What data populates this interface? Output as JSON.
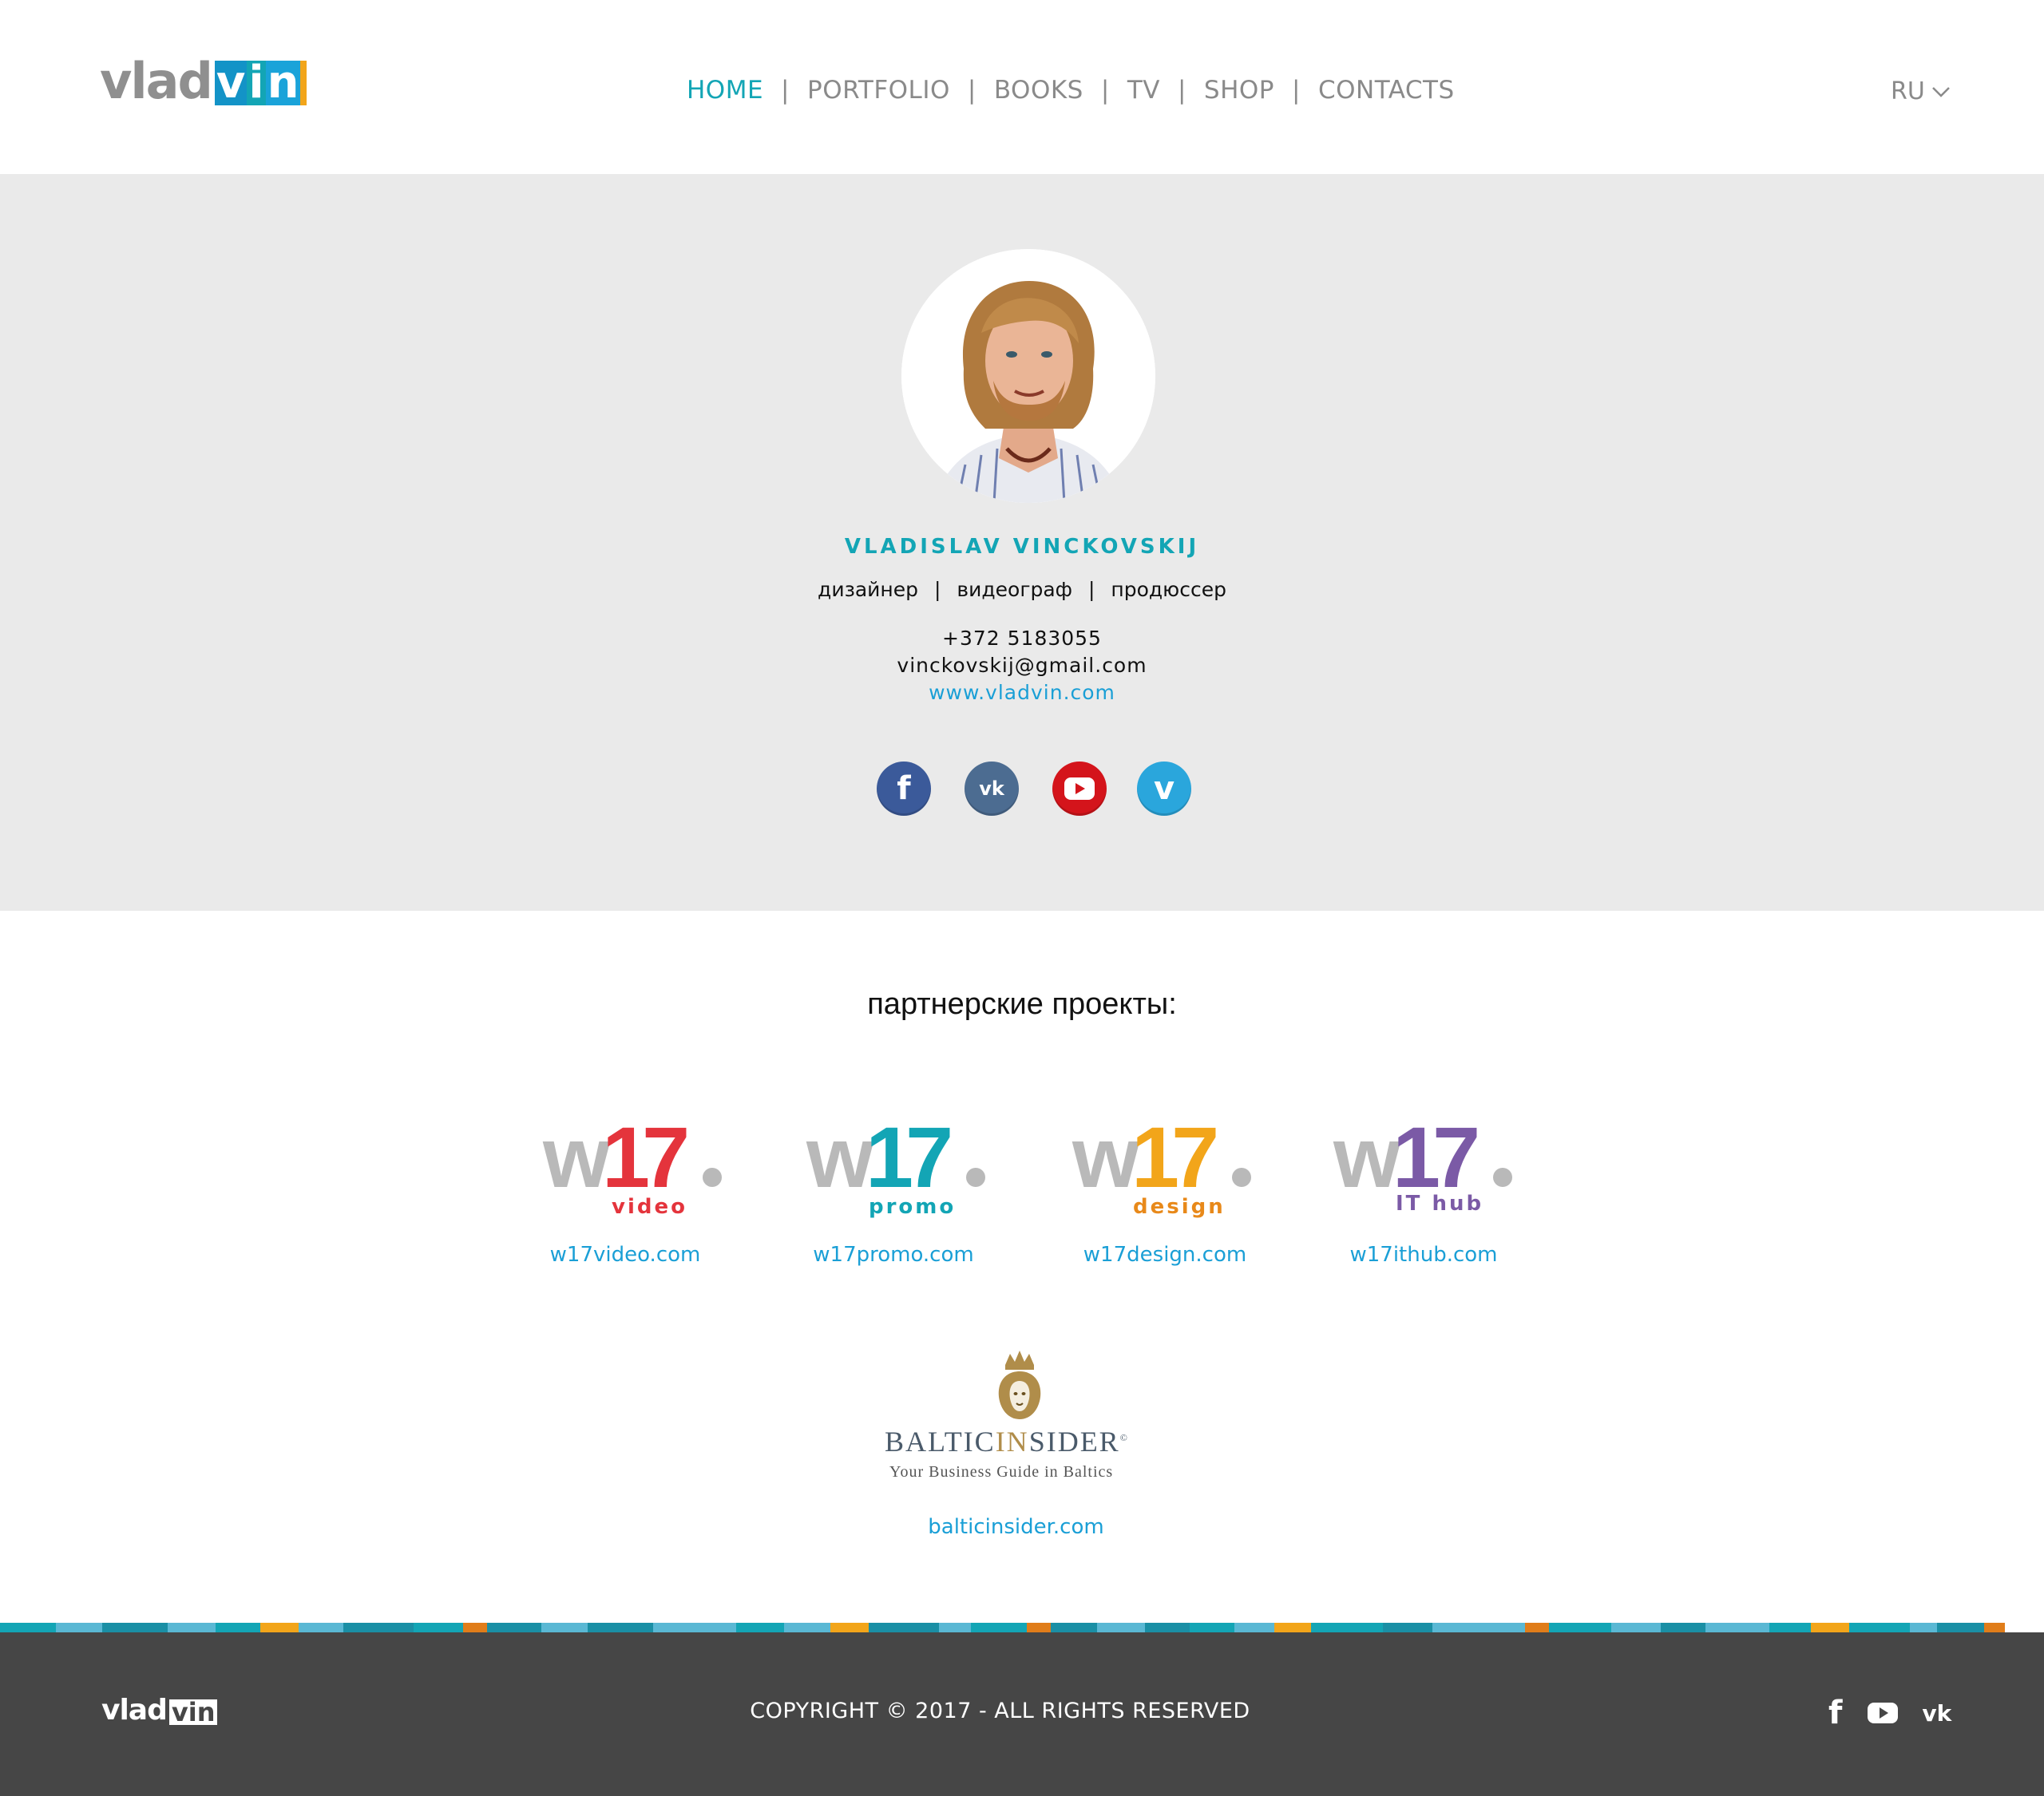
{
  "header": {
    "logo": {
      "part1": "vlad",
      "part2_letters": [
        "v",
        "i",
        "n"
      ],
      "letter_colors": [
        "#1393c7",
        "#13a5b5",
        "#1aa3d9"
      ],
      "accent_bar": "#f2a51a"
    },
    "nav": [
      {
        "label": "HOME",
        "active": true
      },
      {
        "label": "PORTFOLIO",
        "active": false
      },
      {
        "label": "BOOKS",
        "active": false
      },
      {
        "label": "TV",
        "active": false
      },
      {
        "label": "SHOP",
        "active": false
      },
      {
        "label": "CONTACTS",
        "active": false
      }
    ],
    "nav_separator": "|",
    "language": {
      "value": "RU",
      "icon": "chevron-down-icon"
    }
  },
  "profile": {
    "name": "VLADISLAV  VINCKOVSKIJ",
    "roles": [
      "дизайнер",
      "видеограф",
      "продюссер"
    ],
    "role_separator": "|",
    "phone": "+372 5183055",
    "email": "vinckovskij@gmail.com",
    "website": "www.vladvin.com",
    "socials": [
      {
        "name": "facebook",
        "icon": "facebook-icon",
        "glyph": "f",
        "color": "#3b5a9a"
      },
      {
        "name": "vk",
        "icon": "vk-icon",
        "glyph": "vk",
        "color": "#4c6c91"
      },
      {
        "name": "youtube",
        "icon": "youtube-icon",
        "glyph": "▶",
        "color": "#d4141b"
      },
      {
        "name": "vimeo",
        "icon": "vimeo-icon",
        "glyph": "v",
        "color": "#2aa6dc"
      }
    ]
  },
  "partners": {
    "title": "партнерские проекты:",
    "projects": [
      {
        "mark_w": "w",
        "mark_num": "17",
        "mark_dot": ".",
        "sub": "video",
        "color": "#e4343c",
        "link": "w17video.com"
      },
      {
        "mark_w": "w",
        "mark_num": "17",
        "mark_dot": ".",
        "sub": "promo",
        "color": "#13a5b5",
        "link": "w17promo.com"
      },
      {
        "mark_w": "w",
        "mark_num": "17",
        "mark_dot": ".",
        "sub": "design",
        "color": "#f2a51a",
        "link": "w17design.com"
      },
      {
        "mark_w": "w",
        "mark_num": "17",
        "mark_dot": ".",
        "sub": "IT hub",
        "color": "#7b5aa6",
        "link": "w17ithub.com"
      }
    ],
    "baltic": {
      "word_a": "BALTIC",
      "word_b": "IN",
      "word_c": "SIDER",
      "reg": "©",
      "tagline": "Your Business Guide in Baltics",
      "link": "balticinsider.com"
    }
  },
  "footer": {
    "logo": {
      "part1": "vlad",
      "part2": "vin"
    },
    "copyright": "COPYRIGHT © 2017 - ALL RIGHTS RESERVED",
    "icons": [
      {
        "name": "facebook-icon",
        "glyph": "f"
      },
      {
        "name": "youtube-icon",
        "glyph": "▶"
      },
      {
        "name": "vk-icon",
        "glyph": "vk"
      }
    ],
    "stripe_colors": [
      "#13a5b5",
      "#5ab8d4",
      "#1a8fa5",
      "#f2a51a",
      "#e07d1a"
    ]
  }
}
